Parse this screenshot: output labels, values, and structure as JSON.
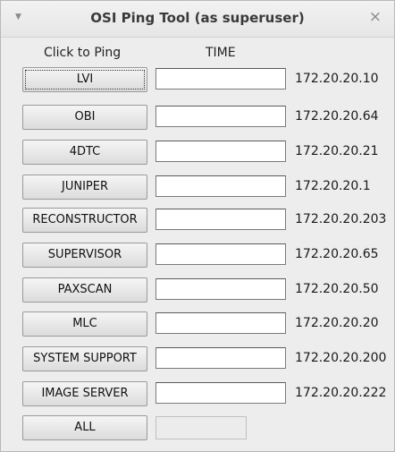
{
  "window": {
    "title": "OSI Ping Tool (as superuser)",
    "menu_glyph": "▼",
    "close_glyph": "×"
  },
  "headers": {
    "ping": "Click to Ping",
    "time": "TIME"
  },
  "rows": [
    {
      "label": "LVI",
      "time": "",
      "ip": "172.20.20.10"
    },
    {
      "label": "OBI",
      "time": "",
      "ip": "172.20.20.64"
    },
    {
      "label": "4DTC",
      "time": "",
      "ip": "172.20.20.21"
    },
    {
      "label": "JUNIPER",
      "time": "",
      "ip": "172.20.20.1"
    },
    {
      "label": "RECONSTRUCTOR",
      "time": "",
      "ip": "172.20.20.203"
    },
    {
      "label": "SUPERVISOR",
      "time": "",
      "ip": "172.20.20.65"
    },
    {
      "label": "PAXSCAN",
      "time": "",
      "ip": "172.20.20.50"
    },
    {
      "label": "MLC",
      "time": "",
      "ip": "172.20.20.20"
    },
    {
      "label": "SYSTEM SUPPORT",
      "time": "",
      "ip": "172.20.20.200"
    },
    {
      "label": "IMAGE SERVER",
      "time": "",
      "ip": "172.20.20.222"
    }
  ],
  "all": {
    "label": "ALL",
    "time": ""
  }
}
